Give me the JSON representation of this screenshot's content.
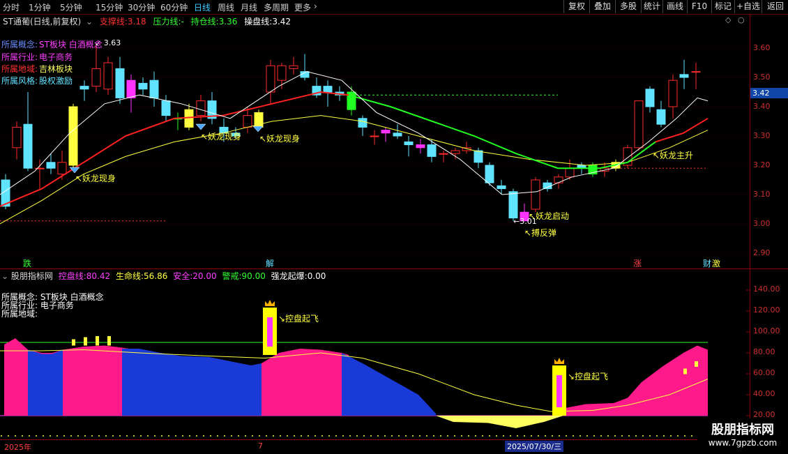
{
  "toolbar": {
    "periods": [
      "分时",
      "1分钟",
      "5分钟",
      "15分钟",
      "30分钟",
      "60分钟",
      "日线",
      "周线",
      "月线",
      "多周期",
      "更多"
    ],
    "active_period": "日线",
    "more_arrow": "›",
    "buttons": [
      "复权",
      "叠加",
      "多股",
      "统计",
      "画线",
      "F10",
      "标记",
      "+自选",
      "返回"
    ]
  },
  "main_chart": {
    "stock_title": "ST通葡(日线,前复权)",
    "support_label": "支撑线:",
    "support_value": "3.18",
    "pressure_label": "压力线:",
    "pressure_value": "-",
    "hold_label": "持仓线:",
    "hold_value": "3.36",
    "trade_label": "操盘线:",
    "trade_value": "3.42",
    "concept_key": "所属概念:",
    "concept_val": "ST板块 白酒概念",
    "industry_key": "所属行业:",
    "industry_val": "电子商务",
    "region_key": "所属地域:",
    "region_val": "吉林板块",
    "style_key": "所属风格:",
    "style_val": "股权激励",
    "high_label": "3.63",
    "low_label": "3.01",
    "current_price": "3.42",
    "y_ticks": [
      "3.60",
      "3.50",
      "3.40",
      "3.30",
      "3.20",
      "3.10",
      "3.00",
      "2.90"
    ],
    "annotations": [
      "妖龙现身",
      "妖龙现身",
      "妖龙现身",
      "妖龙启动",
      "搏反弹",
      "妖龙主升"
    ],
    "bottom_marks": [
      "跌",
      "解",
      "涨",
      "财",
      "激"
    ],
    "colors": {
      "up": "#ff2a2a",
      "down": "#5fe3ff",
      "yellow": "#ffff40",
      "green": "#22ff22",
      "magenta": "#ff33ff",
      "red_line": "#ff2020"
    }
  },
  "indicator": {
    "name": "股朋指标网",
    "kong_label": "控盘线:",
    "kong_value": "80.42",
    "life_label": "生命线:",
    "life_value": "56.86",
    "safe_label": "安全:",
    "safe_value": "20.00",
    "warn_label": "警戒:",
    "warn_value": "90.00",
    "dragon_label": "强龙起爆:",
    "dragon_value": "0.00",
    "concept_line": "所属概念: ST板块 白酒概念",
    "industry_line": "所属行业: 电子商务",
    "region_line": "所属地域:",
    "signal_label": "控盘起飞",
    "y_ticks": [
      "140.00",
      "120.00",
      "100.00",
      "80.00",
      "60.00",
      "40.00",
      "20.00"
    ]
  },
  "time_axis": {
    "labels": [
      "2025年",
      "7",
      "2025/07/30/三"
    ]
  },
  "brand": {
    "name": "股朋指标网",
    "url": "www.7gpzb.com"
  }
}
